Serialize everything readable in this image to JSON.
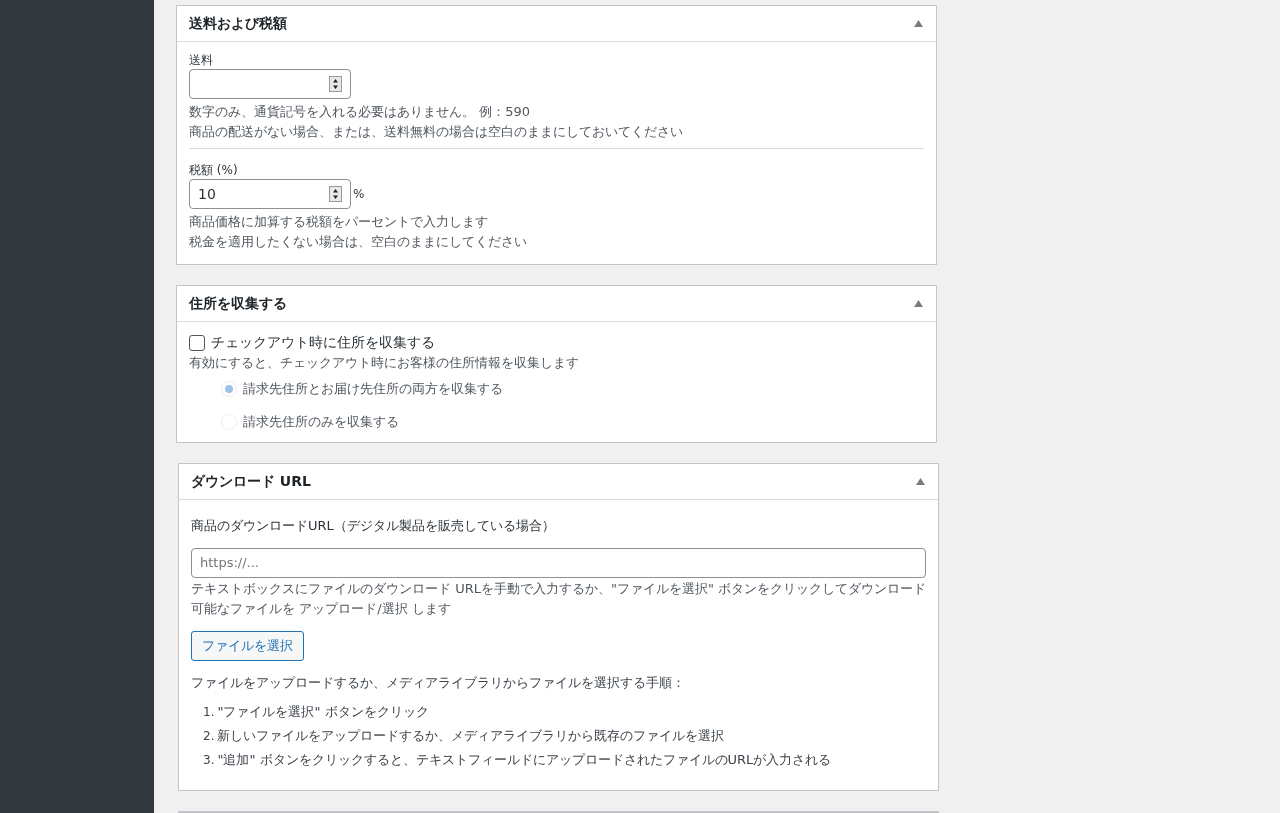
{
  "shipping_tax": {
    "title": "送料および税額",
    "shipping": {
      "label": "送料",
      "help": [
        "数字のみ、通貨記号を入れる必要はありません。 例：590",
        "商品の配送がない場合、または、送料無料の場合は空白のままにしておいてください"
      ]
    },
    "tax": {
      "label": "税額 (%)",
      "value": "10",
      "unit": "%",
      "help": [
        "商品価格に加算する税額をパーセントで入力します",
        "税金を適用したくない場合は、空白のままにしてください"
      ]
    }
  },
  "address": {
    "title": "住所を収集する",
    "checkbox": {
      "label": "チェックアウト時に住所を収集する",
      "checked": false
    },
    "help": "有効にすると、チェックアウト時にお客様の住所情報を収集します",
    "options": [
      {
        "label": "請求先住所とお届け先住所の両方を収集する",
        "selected": true
      },
      {
        "label": "請求先住所のみを収集する",
        "selected": false
      }
    ]
  },
  "download": {
    "title": "ダウンロード URL",
    "label": "商品のダウンロードURL（デジタル製品を販売している場合）",
    "placeholder": "https://...",
    "help": "テキストボックスにファイルのダウンロード URLを手動で入力するか、\"ファイルを選択\" ボタンをクリックしてダウンロード可能なファイルを アップロード/選択 します",
    "button": "ファイルを選択",
    "steps_title": "ファイルをアップロードするか、メディアライブラリからファイルを選択する手順：",
    "steps": [
      {
        "number": "1.",
        "text": "\"ファイルを選択\" ボタンをクリック"
      },
      {
        "number": "2.",
        "text": "新しいファイルをアップロードするか、メディアライブラリから既存のファイルを選択"
      },
      {
        "number": "3.",
        "text": "\"追加\" ボタンをクリックすると、テキストフィールドにアップロードされたファイルのURLが入力される"
      }
    ]
  }
}
